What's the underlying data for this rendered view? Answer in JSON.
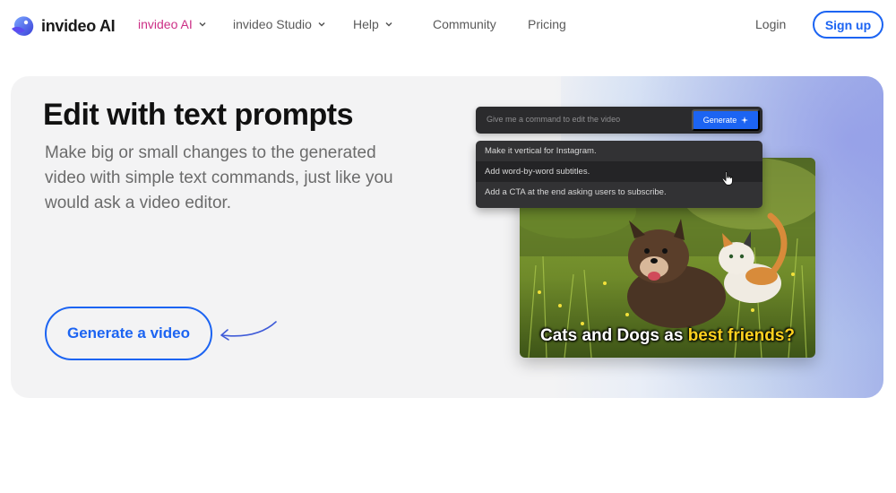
{
  "nav": {
    "brand": "invideo AI",
    "items": [
      {
        "label": "invideo AI",
        "has_dropdown": true,
        "active": true
      },
      {
        "label": "invideo Studio",
        "has_dropdown": true
      },
      {
        "label": "Help",
        "has_dropdown": true
      },
      {
        "label": "Community",
        "has_dropdown": false
      },
      {
        "label": "Pricing",
        "has_dropdown": false
      }
    ],
    "login": "Login",
    "signup": "Sign up"
  },
  "hero": {
    "headline": "Edit with text prompts",
    "subheadline": "Make big or small changes to the generated video with simple text commands, just like you would ask a video editor.",
    "cta": "Generate a video"
  },
  "editor": {
    "placeholder": "Give me a command to edit the video",
    "generate": "Generate",
    "suggestions": [
      "Make it vertical for Instagram.",
      "Add word-by-word subtitles.",
      "Add a CTA at the end asking users to subscribe."
    ],
    "caption_main": "Cats and Dogs as",
    "caption_highlight": "best friends?"
  },
  "colors": {
    "accent": "#1c64f2",
    "active_nav": "#cc2f86",
    "caption_highlight": "#ffd21f"
  }
}
